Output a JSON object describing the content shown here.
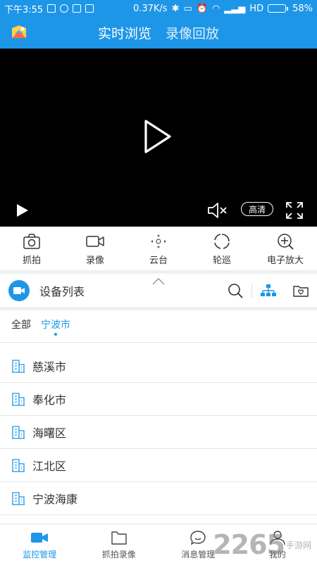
{
  "status_bar": {
    "time": "下午3:55",
    "speed": "0.37K/s",
    "network": "HD",
    "battery": "58%",
    "battery_level": 0.58
  },
  "header": {
    "tabs": [
      "实时浏览",
      "录像回放"
    ],
    "active_tab": 0
  },
  "video": {
    "quality_label": "高清"
  },
  "controls": [
    {
      "label": "抓拍",
      "icon": "camera-icon"
    },
    {
      "label": "录像",
      "icon": "video-record-icon"
    },
    {
      "label": "云台",
      "icon": "ptz-icon"
    },
    {
      "label": "轮巡",
      "icon": "patrol-icon"
    },
    {
      "label": "电子放大",
      "icon": "zoom-in-icon"
    }
  ],
  "device_list": {
    "title": "设备列表"
  },
  "breadcrumb": {
    "items": [
      "全部",
      "宁波市"
    ],
    "active": 1
  },
  "devices": [
    {
      "name": "慈溪市"
    },
    {
      "name": "奉化市"
    },
    {
      "name": "海曙区"
    },
    {
      "name": "江北区"
    },
    {
      "name": "宁波海康"
    }
  ],
  "bottom_nav": [
    {
      "label": "监控管理",
      "icon": "monitor-icon",
      "active": true
    },
    {
      "label": "抓拍录像",
      "icon": "folder-icon",
      "active": false
    },
    {
      "label": "消息管理",
      "icon": "message-icon",
      "active": false
    },
    {
      "label": "我的",
      "icon": "profile-icon",
      "active": false
    }
  ],
  "watermark": {
    "number": "2265",
    "site": "手游网"
  },
  "colors": {
    "accent": "#1e96e8",
    "video_bg": "#000000"
  }
}
